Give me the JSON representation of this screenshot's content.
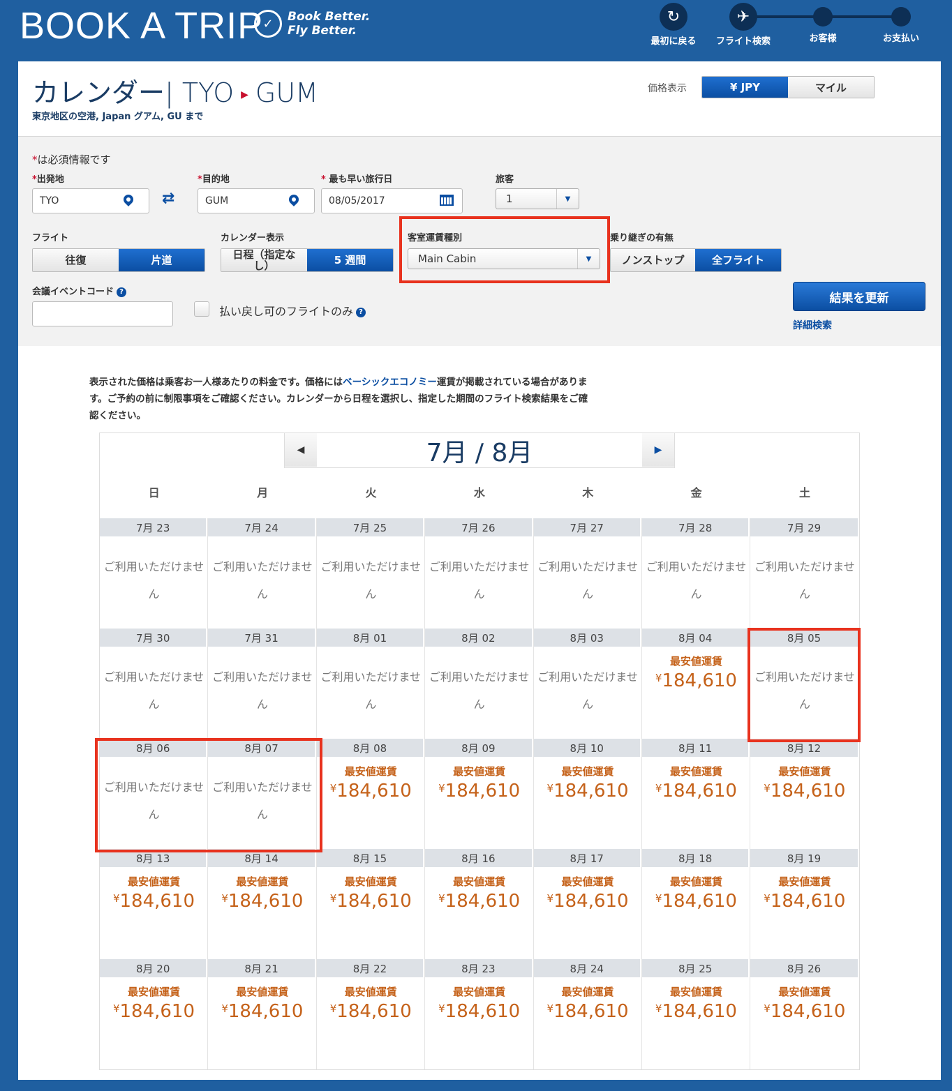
{
  "header": {
    "title": "BOOK A TRIP",
    "tagline_line1": "Book Better.",
    "tagline_line2": "Fly Better.",
    "steps": [
      {
        "label": "最初に戻る",
        "icon": "restart-icon"
      },
      {
        "label": "フライト検索",
        "icon": "plane-icon"
      },
      {
        "label": "お客様",
        "icon": "dot"
      },
      {
        "label": "お支払い",
        "icon": "dot"
      }
    ]
  },
  "page": {
    "title_prefix": "カレンダー| TYO",
    "title_dest": "GUM",
    "subtitle": "東京地区の空港, Japan グアム, GU まで",
    "price_display_label": "価格表示",
    "price_options": [
      "¥ JPY",
      "マイル"
    ],
    "price_selected": "¥ JPY"
  },
  "search": {
    "required_note": "は必須情報です",
    "origin_label": "出発地",
    "origin_value": "TYO",
    "dest_label": "目的地",
    "dest_value": "GUM",
    "date_label": "最も早い旅行日",
    "date_value": "08/05/2017",
    "pax_label": "旅客",
    "pax_value": "1",
    "flight_label": "フライト",
    "flight_options": [
      "往復",
      "片道"
    ],
    "flight_selected": "片道",
    "calview_label": "カレンダー表示",
    "calview_options": [
      "日程（指定なし）",
      "5 週間"
    ],
    "calview_selected": "5 週間",
    "cabin_label": "客室運賃種別",
    "cabin_value": "Main Cabin",
    "connect_label": "乗り継ぎの有無",
    "connect_options": [
      "ノンストップ",
      "全フライト"
    ],
    "connect_selected": "全フライト",
    "event_code_label": "会議イベントコード",
    "event_code_value": "",
    "refundable_label": "払い戻し可のフライトのみ",
    "refundable_checked": false,
    "update_button": "結果を更新",
    "advanced_link": "詳細検索"
  },
  "calendar": {
    "disclaimer_before": "表示された価格は乗客お一人様あたりの料金です。価格には",
    "disclaimer_link": "ベーシックエコノミー",
    "disclaimer_after": "運賃が掲載されている場合があります。ご予約の前に制限事項をご確認ください。カレンダーから日程を選択し、指定した期間のフライト検索結果をご確認ください。",
    "month_label": "7月 / 8月",
    "weekdays": [
      "日",
      "月",
      "火",
      "水",
      "木",
      "金",
      "土"
    ],
    "unavailable_text": "ご利用いただけません",
    "price_label": "最安値運賃",
    "currency_symbol": "¥",
    "weeks": [
      [
        {
          "date": "7月 23",
          "price": null
        },
        {
          "date": "7月 24",
          "price": null
        },
        {
          "date": "7月 25",
          "price": null
        },
        {
          "date": "7月 26",
          "price": null
        },
        {
          "date": "7月 27",
          "price": null
        },
        {
          "date": "7月 28",
          "price": null
        },
        {
          "date": "7月 29",
          "price": null
        }
      ],
      [
        {
          "date": "7月 30",
          "price": null
        },
        {
          "date": "7月 31",
          "price": null
        },
        {
          "date": "8月 01",
          "price": null
        },
        {
          "date": "8月 02",
          "price": null
        },
        {
          "date": "8月 03",
          "price": null
        },
        {
          "date": "8月 04",
          "price": "184,610"
        },
        {
          "date": "8月 05",
          "price": null
        }
      ],
      [
        {
          "date": "8月 06",
          "price": null
        },
        {
          "date": "8月 07",
          "price": null
        },
        {
          "date": "8月 08",
          "price": "184,610"
        },
        {
          "date": "8月 09",
          "price": "184,610"
        },
        {
          "date": "8月 10",
          "price": "184,610"
        },
        {
          "date": "8月 11",
          "price": "184,610"
        },
        {
          "date": "8月 12",
          "price": "184,610"
        }
      ],
      [
        {
          "date": "8月 13",
          "price": "184,610"
        },
        {
          "date": "8月 14",
          "price": "184,610"
        },
        {
          "date": "8月 15",
          "price": "184,610"
        },
        {
          "date": "8月 16",
          "price": "184,610"
        },
        {
          "date": "8月 17",
          "price": "184,610"
        },
        {
          "date": "8月 18",
          "price": "184,610"
        },
        {
          "date": "8月 19",
          "price": "184,610"
        }
      ],
      [
        {
          "date": "8月 20",
          "price": "184,610"
        },
        {
          "date": "8月 21",
          "price": "184,610"
        },
        {
          "date": "8月 22",
          "price": "184,610"
        },
        {
          "date": "8月 23",
          "price": "184,610"
        },
        {
          "date": "8月 24",
          "price": "184,610"
        },
        {
          "date": "8月 25",
          "price": "184,610"
        },
        {
          "date": "8月 26",
          "price": "184,610"
        }
      ]
    ]
  },
  "colors": {
    "brand_blue": "#1f5fa0",
    "active_blue": "#0b4ea2",
    "price_orange": "#c5621a",
    "highlight_red": "#e8321e"
  }
}
